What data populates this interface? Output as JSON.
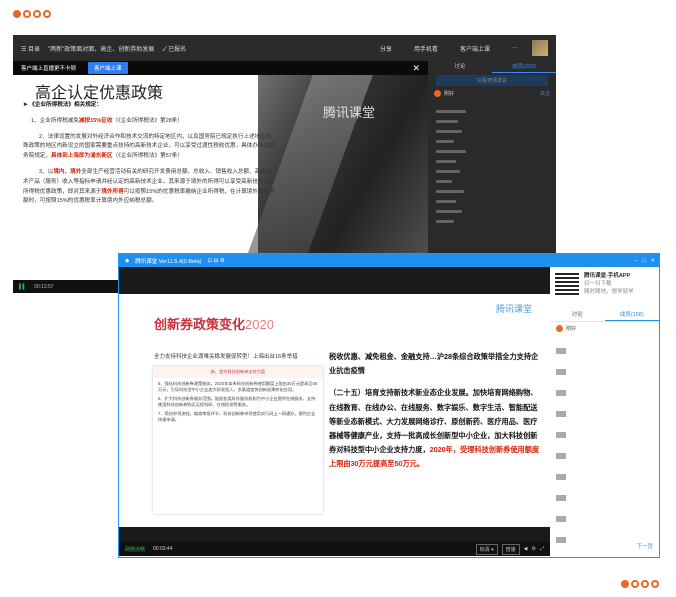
{
  "window1": {
    "topbar": {
      "menu_label": "☰ 目录",
      "course_title": "\"两新\"政策面对面，高企、创新券助发展",
      "status": "✓ 已报名",
      "share": "分享",
      "phone": "用手机看",
      "client": "客户端上课",
      "more": "···"
    },
    "banner": {
      "text": "客户端上直播更不卡顿",
      "button": "客户端上课"
    },
    "slide": {
      "title": "高企认定优惠政策",
      "heading": "《企业所得税法》相关规定：",
      "p1_a": "1、企业所得税减免",
      "p1_red": "减按15%征收",
      "p1_b": "（《企业所得税法》第28条）",
      "p2_a": "2、法律设置的发展对外经济合作和技术交流的特定地区内，以及国务院已规定执行上述地区特殊政策的地区内新设立的国家需要重点扶持的高新技术企业，可以享受过渡性税收优惠，具体办法由国务院规定，",
      "p2_red": "具体到上海即为浦东新区",
      "p2_b": "（《企业所得税法》第57条）",
      "p3_a": "3、以",
      "p3_red1": "境内、境外",
      "p3_b": "全部生产经营活动有关的研究开发费用总额、总收入、销售收入总额、高新技术产品（服务）收入等指标申请并经认定的高新技术企业，其来源于境外的所得可以享受高新技术企业所得税优惠政策，即对其来源于",
      "p3_red2": "境外所得",
      "p3_c": "可以按照15%的优惠税率缴纳企业所得税，在计算境外抵免限额时，可按照15%的优惠税率计算境内外应纳税总额。"
    },
    "watermark": "腾讯课堂",
    "time": "00:12:57",
    "side": {
      "tab1": "讨论",
      "tab2": "成员(203)",
      "row_label": "只看老师发言",
      "user": "刚好",
      "follow": "关注",
      "item": "类型"
    }
  },
  "window2": {
    "title": "腾讯课堂 Ver11.5.4(0 Beta)",
    "slide": {
      "title": "创新券政策变化",
      "year": "2020",
      "logo": "腾讯课堂",
      "subtitle": "全力支持科技企业渡难关稳发展促转型！上海出台16条举措",
      "doc_head": "新、加大科技创新券支持力度",
      "doc_p1": "5、强化科技创新券政策服务。2020年本市科技创新券使用额度上限由30万元提高至50万元，引导科技型中小企业加大研发投入，多渠道加快创新成果转化应用。",
      "doc_p2": "6、扩大科技创新券服务范围。鼓励各类科技服务机构为中小企业提供在线服务，支持使用科技创新券购买远程科研、在线检测等服务。",
      "doc_p3": "7、简化申领流程。缩减审批环节，科技创新券申领使用实行网上一网通办，便利企业快速申请。",
      "text": "税收优惠、减免租金、金融支持…沪28条综合政策举措全力支持企业抗击疫情",
      "text2": "（二十五）培育支持新技术新业态企业发展。加快培育网络购物、在线教育、在线办公、在线服务、数字娱乐、数字生活、智能配送等新业态新模式、大力发展网络诊疗、原创新药、医疗用品、医疗器械等健康产业，支持一批高成长创新型中小企业，加大科技创新券对科技型中小企业支持力度，",
      "text2_red": "2020年，受理科技创新券使用额度上限由30万元提高至50万元。"
    },
    "ctrl": {
      "live": "网络流畅",
      "time": "00:03:44",
      "quality": "标清 ▾",
      "speed": "倍速"
    },
    "side": {
      "qr_title": "腾讯课堂-手机APP",
      "qr_sub1": "扫一扫下载",
      "qr_sub2": "随时随地，想学就学",
      "tab1": "讨论",
      "tab2": "成员(158)",
      "user": "刚好",
      "next": "下一页"
    }
  },
  "colors": {
    "accent": "#e8682a",
    "blue": "#1f8ff0",
    "red": "#d81e06"
  }
}
